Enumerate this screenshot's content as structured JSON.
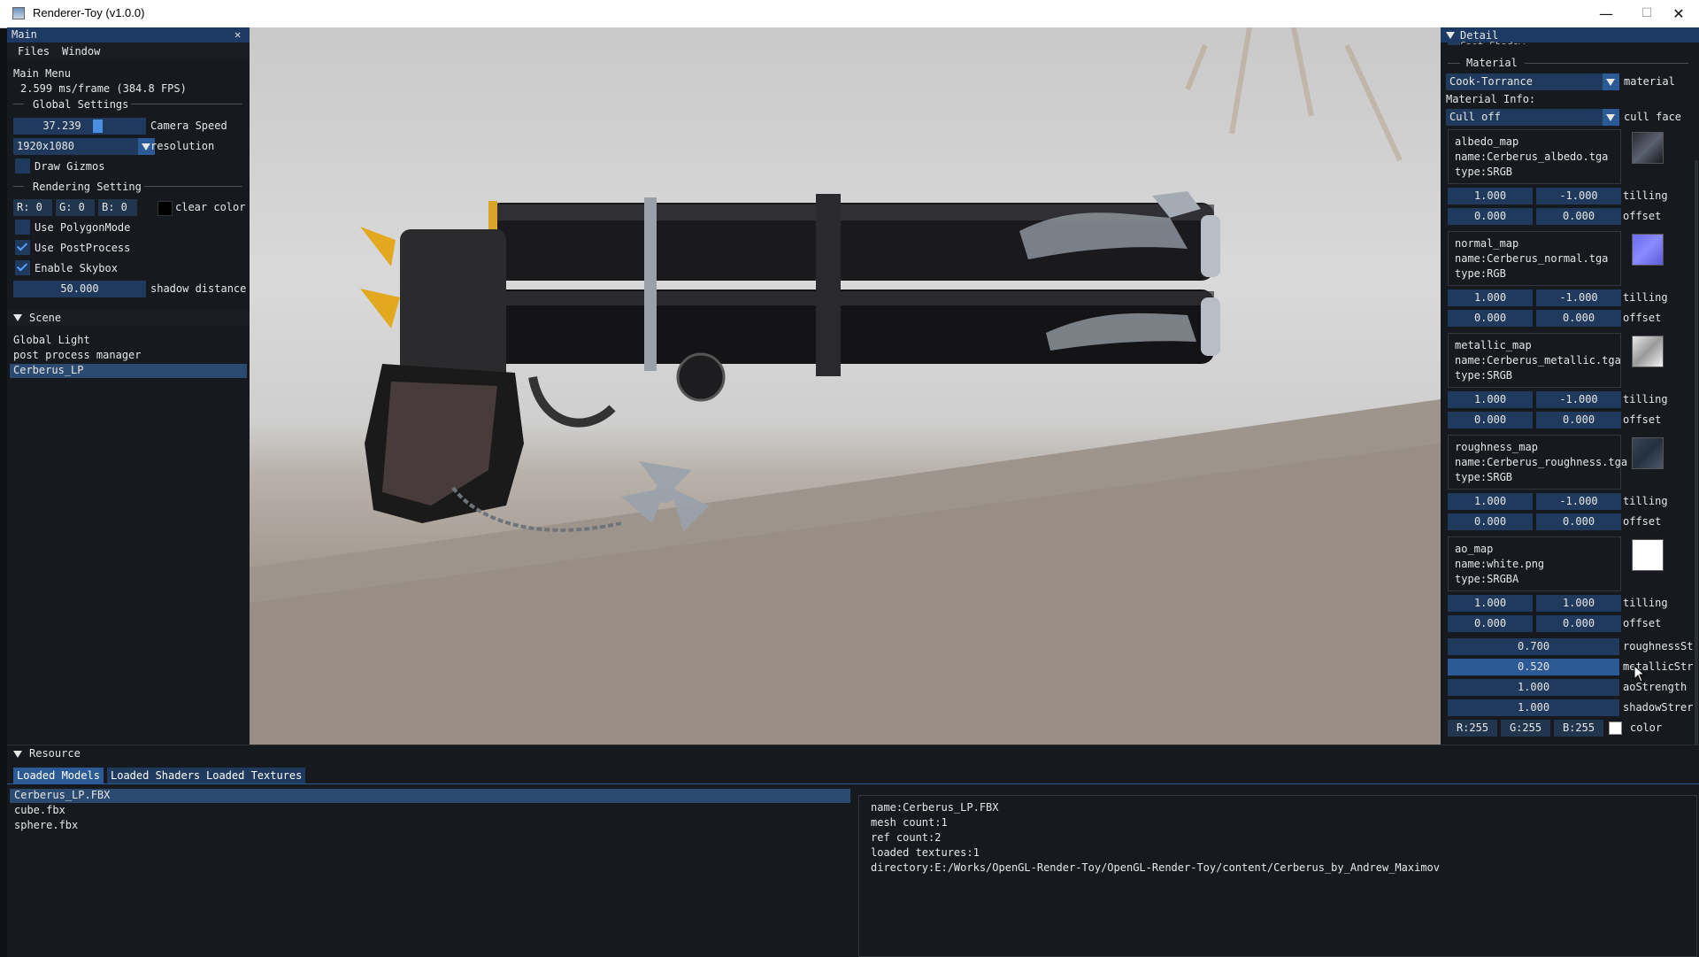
{
  "window": {
    "title": "Renderer-Toy (v1.0.0)",
    "minimize": "—",
    "maximize": "☐",
    "close": "✕"
  },
  "main": {
    "title": "Main",
    "close": "✕",
    "menu": [
      "Files",
      "Window"
    ],
    "main_menu_label": "Main Menu",
    "fps": "2.599 ms/frame (384.8 FPS)",
    "global_settings": "Global Settings",
    "camera_speed": {
      "value": "37.239",
      "label": "Camera Speed",
      "fraction": 0.75
    },
    "resolution": {
      "value": "1920x1080",
      "label": "resolution"
    },
    "draw_gizmos": {
      "label": "Draw Gizmos",
      "checked": false
    },
    "rendering_setting": "Rendering Setting",
    "clear_color": {
      "r": "R:  0",
      "g": "G:  0",
      "b": "B:  0",
      "label": "clear color"
    },
    "use_polygon_mode": {
      "label": "Use PolygonMode",
      "checked": false
    },
    "use_postprocess": {
      "label": "Use PostProcess",
      "checked": true
    },
    "enable_skybox": {
      "label": "Enable Skybox",
      "checked": true
    },
    "shadow_distance": {
      "value": "50.000",
      "label": "shadow distance"
    }
  },
  "scene": {
    "title": "Scene",
    "items": [
      "Global Light",
      "post process manager",
      "Cerberus_LP"
    ],
    "selected": 2
  },
  "detail": {
    "title": "Detail",
    "cast_shadow": "Cast Shadow",
    "material_header": "Material",
    "material": {
      "value": "Cook-Torrance",
      "label": "material"
    },
    "material_info": "Material Info:",
    "cull_face": {
      "value": "Cull off",
      "label": "cull face"
    },
    "maps": [
      {
        "title": "albedo_map",
        "name": "name:Cerberus_albedo.tga",
        "type": "type:SRGB",
        "tilling": [
          "1.000",
          "-1.000"
        ],
        "offset": [
          "0.000",
          "0.000"
        ],
        "thumb": "albedo-thumbnail"
      },
      {
        "title": "normal_map",
        "name": "name:Cerberus_normal.tga",
        "type": "type:RGB",
        "tilling": [
          "1.000",
          "-1.000"
        ],
        "offset": [
          "0.000",
          "0.000"
        ],
        "thumb": "normal-thumbnail"
      },
      {
        "title": "metallic_map",
        "name": "name:Cerberus_metallic.tga",
        "type": "type:SRGB",
        "tilling": [
          "1.000",
          "-1.000"
        ],
        "offset": [
          "0.000",
          "0.000"
        ],
        "thumb": "metallic-thumbnail"
      },
      {
        "title": "roughness_map",
        "name": "name:Cerberus_roughness.tga",
        "type": "type:SRGB",
        "tilling": [
          "1.000",
          "-1.000"
        ],
        "offset": [
          "0.000",
          "0.000"
        ],
        "thumb": "roughness-thumbnail"
      },
      {
        "title": "ao_map",
        "name": "name:white.png",
        "type": "type:SRGBA",
        "tilling": [
          "1.000",
          "1.000"
        ],
        "offset": [
          "0.000",
          "0.000"
        ],
        "thumb": "ao-thumbnail"
      }
    ],
    "tilling_label": "tilling",
    "offset_label": "offset",
    "roughness_strength": {
      "value": "0.700",
      "label": "roughnessSt"
    },
    "metallic_strength": {
      "value": "0.520",
      "label": "metallicStr"
    },
    "ao_strength": {
      "value": "1.000",
      "label": "aoStrength"
    },
    "shadow_strength": {
      "value": "1.000",
      "label": "shadowStrer"
    },
    "color": {
      "r": "R:255",
      "g": "G:255",
      "b": "B:255",
      "label": "color",
      "swatch": "#ffffff"
    }
  },
  "resource": {
    "title": "Resource",
    "tabs": [
      "Loaded Models",
      "Loaded Shaders",
      "Loaded Textures"
    ],
    "active_tab": 0,
    "models": [
      "Cerberus_LP.FBX",
      "cube.fbx",
      "sphere.fbx"
    ],
    "selected_model": 0,
    "info": [
      "name:Cerberus_LP.FBX",
      "mesh count:1",
      "ref count:2",
      "loaded textures:1",
      "directory:E:/Works/OpenGL-Render-Toy/OpenGL-Render-Toy/content/Cerberus_by_Andrew_Maximov"
    ]
  },
  "colors": {
    "accent": "#2b5a96",
    "field": "#1f3a5c",
    "panel": "#161a1e",
    "header": "#1c3a63"
  }
}
